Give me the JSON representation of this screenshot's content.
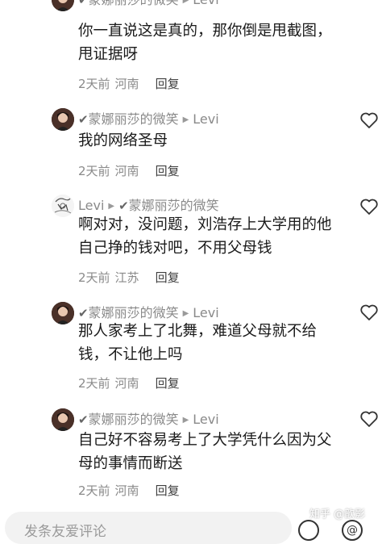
{
  "comments": [
    {
      "author": "蒙娜丽莎的微笑",
      "reply_to": "Levi",
      "text": "你一直说这是真的，那你倒是甩截图，甩证据呀",
      "time": "2天前",
      "location": "河南",
      "reply_label": "回复",
      "avatar": "portrait-dark-hair"
    },
    {
      "author": "蒙娜丽莎的微笑",
      "reply_to": "Levi",
      "text": "我的网络圣母",
      "time": "2天前",
      "location": "河南",
      "reply_label": "回复",
      "avatar": "portrait-dark-hair"
    },
    {
      "author": "Levi",
      "reply_to": "蒙娜丽莎的微笑",
      "text": "啊对对，没问题，刘浩存上大学用的他自己挣的钱对吧，不用父母钱",
      "time": "2天前",
      "location": "江苏",
      "reply_label": "回复",
      "avatar": "sketch-drawing"
    },
    {
      "author": "蒙娜丽莎的微笑",
      "reply_to": "Levi",
      "text": "那人家考上了北舞，难道父母就不给钱，不让他上吗",
      "time": "2天前",
      "location": "河南",
      "reply_label": "回复",
      "avatar": "portrait-dark-hair"
    },
    {
      "author": "蒙娜丽莎的微笑",
      "reply_to": "Levi",
      "text": "自己好不容易考上了大学凭什么因为父母的事情而断送",
      "time": "2天前",
      "location": "河南",
      "reply_label": "回复",
      "avatar": "portrait-dark-hair"
    }
  ],
  "verify_mark": "✔",
  "reply_arrow": "▶",
  "input": {
    "placeholder": "发条友爱评论"
  },
  "watermark": "知乎 @歆影",
  "colors": {
    "meta_gray": "#8a8a8a",
    "text": "#1a1a1a",
    "input_bg": "#f2f2f2"
  }
}
